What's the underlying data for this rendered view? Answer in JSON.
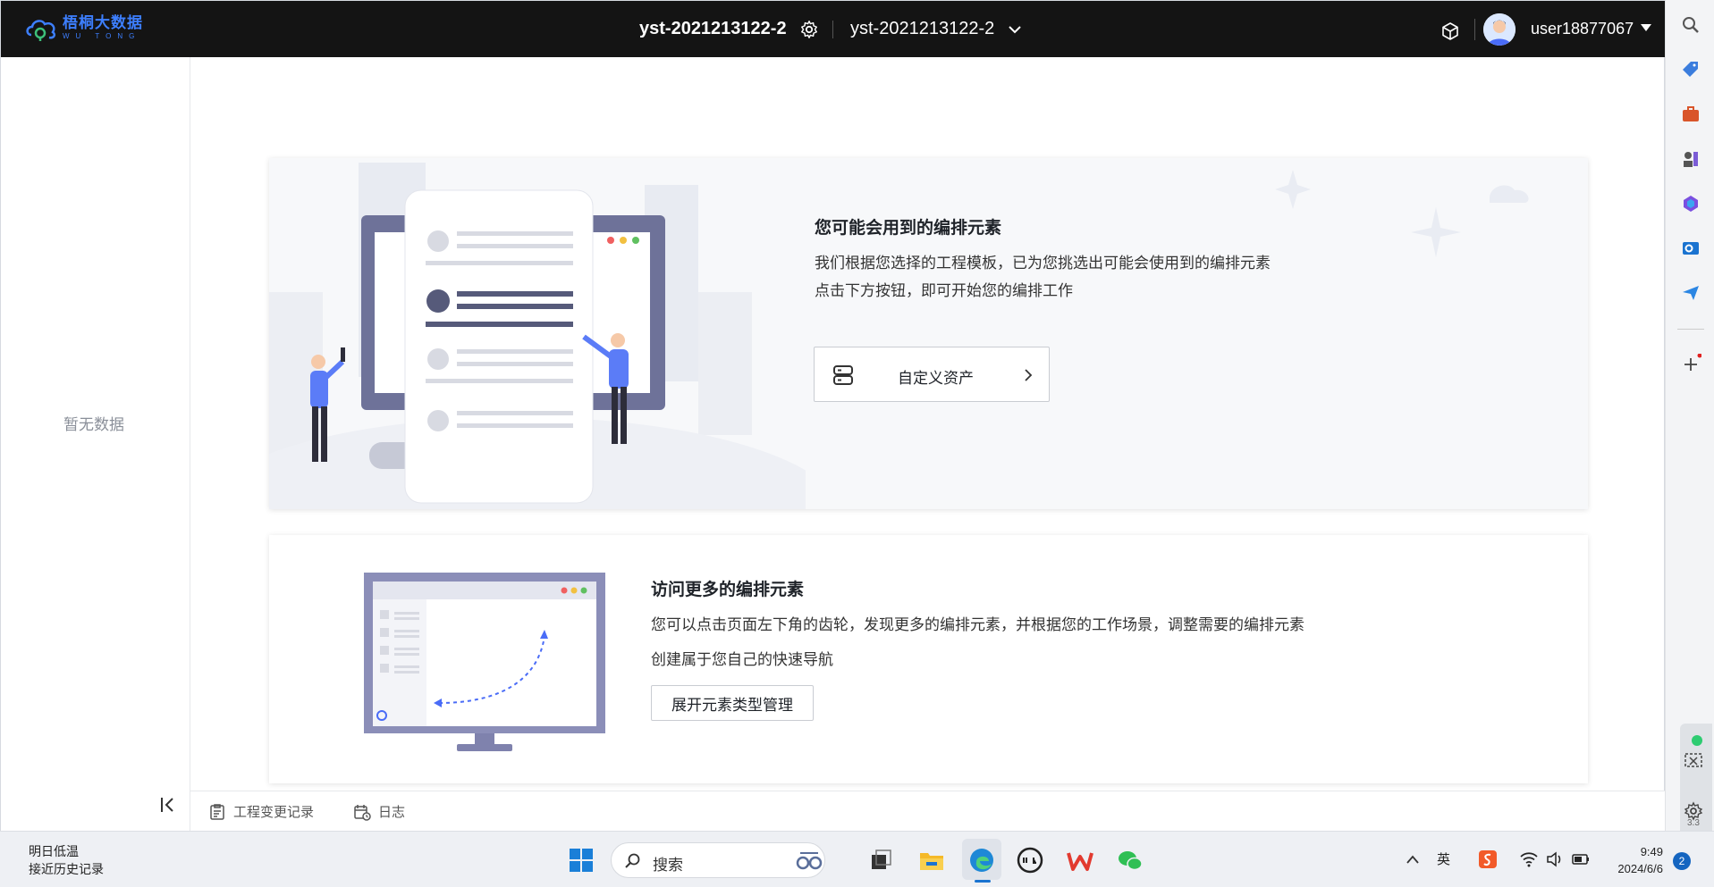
{
  "app": {
    "logo_cn": "梧桐大数据",
    "logo_en": "WU TONG",
    "project_title": "yst-2021213122-2",
    "env_name": "yst-2021213122-2",
    "username": "user18877067"
  },
  "sidebar": {
    "empty_text": "暂无数据"
  },
  "card_suggest": {
    "title": "您可能会用到的编排元素",
    "line1": "我们根据您选择的工程模板，已为您挑选出可能会使用到的编排元素",
    "line2": "点击下方按钮，即可开始您的编排工作",
    "button_label": "自定义资产"
  },
  "card_more": {
    "title": "访问更多的编排元素",
    "line1": "您可以点击页面左下角的齿轮，发现更多的编排元素，并根据您的工作场景，调整需要的编排元素",
    "line2": "创建属于您自己的快速导航",
    "button_label": "展开元素类型管理"
  },
  "bottom_bar": {
    "change_log": "工程变更记录",
    "log": "日志"
  },
  "right_panel": {
    "version": "3.3"
  },
  "taskbar": {
    "weather_title": "明日低温",
    "weather_sub": "接近历史记录",
    "search_label": "搜索",
    "ime": "英",
    "time": "9:49",
    "date": "2024/6/6",
    "notifications": "2"
  },
  "colors": {
    "topbar_bg": "#141414",
    "accent": "#3d7fff",
    "illustration_purple": "#6e7299"
  }
}
